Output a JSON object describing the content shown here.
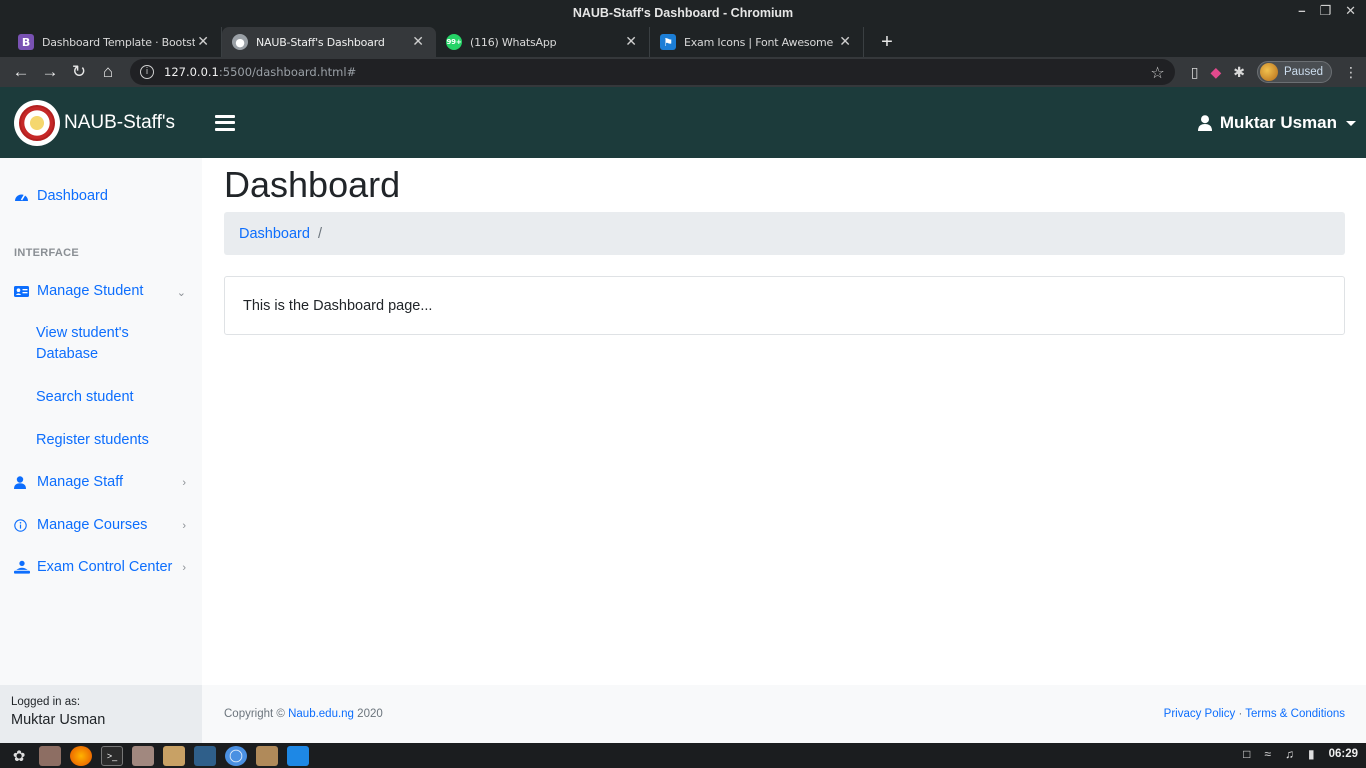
{
  "window": {
    "title": "NAUB-Staff's Dashboard - Chromium"
  },
  "browser": {
    "tabs": [
      {
        "title": "Dashboard Template · Bootstrap v5.",
        "icon": "bootstrap-icon",
        "color": "#7952b3"
      },
      {
        "title": "NAUB-Staff's Dashboard",
        "icon": "globe-icon",
        "color": "#9aa0a6"
      },
      {
        "title": "(116) WhatsApp",
        "icon": "whatsapp-icon",
        "color": "#25d366"
      },
      {
        "title": "Exam Icons | Font Awesome",
        "icon": "flag-icon",
        "color": "#1c7ed6"
      }
    ],
    "url_host": "127.0.0.1",
    "url_path": ":5500/dashboard.html#",
    "profile_status": "Paused"
  },
  "navbar": {
    "brand": "NAUB-Staff's",
    "user": "Muktar Usman",
    "color": "#1c3b3b"
  },
  "sidebar": {
    "dashboard": "Dashboard",
    "heading": "INTERFACE",
    "manage_student": "Manage Student",
    "sub_items": [
      "View student's Database",
      "Search student",
      "Register students"
    ],
    "manage_staff": "Manage Staff",
    "manage_courses": "Manage Courses",
    "exam_control": "Exam Control Center",
    "logged_in_label": "Logged in as:",
    "logged_in_user": "Muktar Usman"
  },
  "main": {
    "title": "Dashboard",
    "breadcrumb": "Dashboard",
    "breadcrumb_sep": "/",
    "card_text": "This is the Dashboard page..."
  },
  "footer": {
    "copyright_prefix": "Copyright ©",
    "site": "Naub.edu.ng",
    "year": "2020",
    "privacy": "Privacy Policy",
    "dot": "·",
    "terms": "Terms & Conditions"
  },
  "taskbar": {
    "clock": "06:29"
  }
}
